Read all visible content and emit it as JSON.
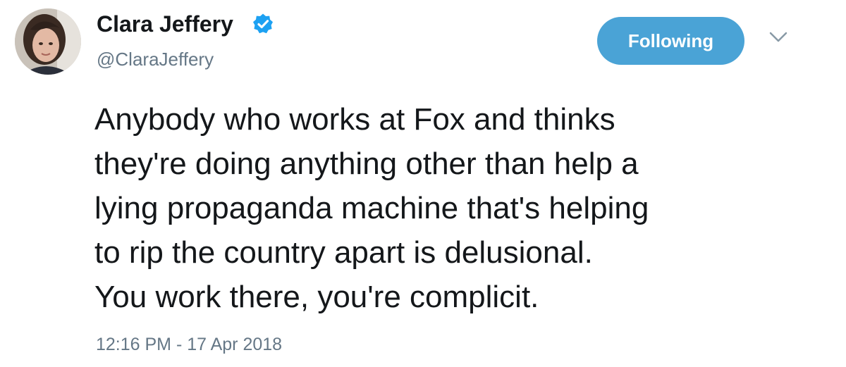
{
  "author": {
    "display_name": "Clara Jeffery",
    "handle": "@ClaraJeffery",
    "verified_icon": "verified-badge-icon",
    "avatar_icon": "avatar"
  },
  "actions": {
    "follow_label": "Following",
    "menu_icon": "chevron-down-icon"
  },
  "tweet": {
    "lines": [
      "Anybody who works at Fox and thinks",
      "they're doing anything other than help a",
      "lying propaganda machine that's helping",
      "to rip the country apart is delusional.",
      "You work there, you're complicit."
    ],
    "timestamp": "12:16 PM - 17 Apr 2018"
  },
  "colors": {
    "follow_button": "#4aa3d6",
    "verified_badge": "#1da1f2",
    "secondary_text": "#657786",
    "primary_text": "#14171a"
  }
}
